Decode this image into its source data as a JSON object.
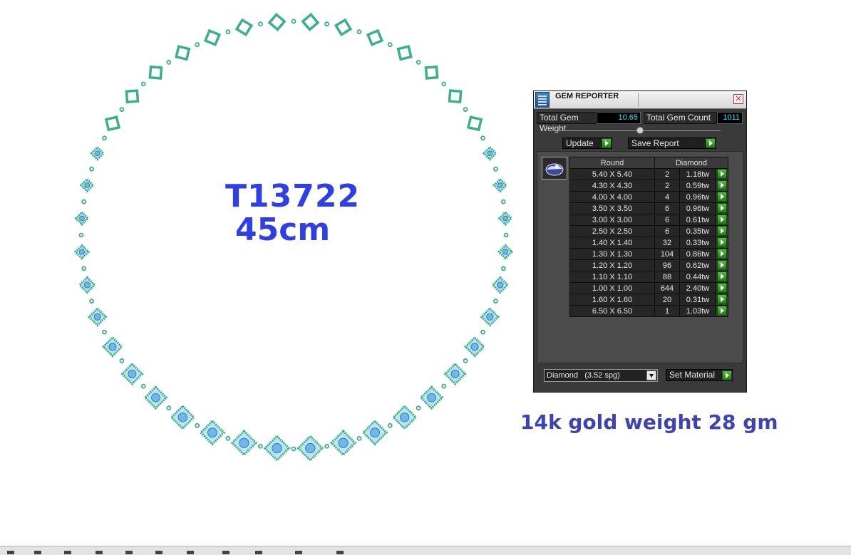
{
  "design": {
    "model_code": "T13722",
    "length": "45cm",
    "gold_weight": "14k gold weight 28 gm",
    "metal_color": "#3bb087",
    "stone_color": "#6fb6ea"
  },
  "gem_reporter": {
    "title": "GEM REPORTER",
    "close_glyph": "×",
    "total_gem_weight_label": "Total Gem Weight",
    "total_gem_weight_value": "10.65",
    "total_gem_count_label": "Total Gem Count",
    "total_gem_count_value": "1011",
    "update_label": "Update",
    "save_report_label": "Save Report",
    "table": {
      "col_shape": "Round",
      "col_material": "Diamond",
      "rows": [
        {
          "size": "5.40 X 5.40",
          "count": "2",
          "weight": "1.18tw"
        },
        {
          "size": "4.30 X 4.30",
          "count": "2",
          "weight": "0.59tw"
        },
        {
          "size": "4.00 X 4.00",
          "count": "4",
          "weight": "0.96tw"
        },
        {
          "size": "3.50 X 3.50",
          "count": "6",
          "weight": "0.96tw"
        },
        {
          "size": "3.00 X 3.00",
          "count": "6",
          "weight": "0.61tw"
        },
        {
          "size": "2.50 X 2.50",
          "count": "6",
          "weight": "0.35tw"
        },
        {
          "size": "1.40 X 1.40",
          "count": "32",
          "weight": "0.33tw"
        },
        {
          "size": "1.30 X 1.30",
          "count": "104",
          "weight": "0.86tw"
        },
        {
          "size": "1.20 X 1.20",
          "count": "96",
          "weight": "0.62tw"
        },
        {
          "size": "1.10 X 1.10",
          "count": "88",
          "weight": "0.44tw"
        },
        {
          "size": "1.00 X 1.00",
          "count": "644",
          "weight": "2.40tw"
        },
        {
          "size": "1.60 X 1.60",
          "count": "20",
          "weight": "0.31tw"
        },
        {
          "size": "6.50 X 6.50",
          "count": "1",
          "weight": "1.03tw"
        }
      ]
    },
    "material_select": {
      "name": "Diamond",
      "spg": "(3.52 spg)"
    },
    "set_material_label": "Set Material"
  }
}
